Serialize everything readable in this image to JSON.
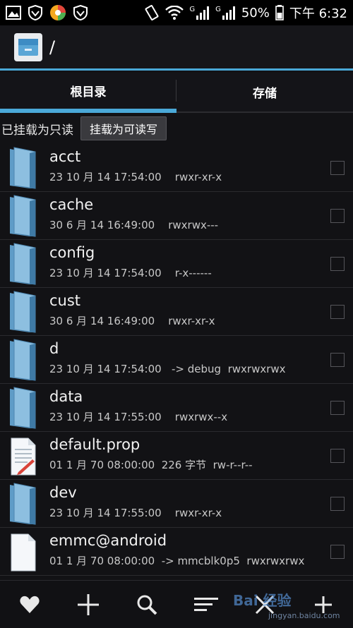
{
  "status_bar": {
    "battery_percent": "50%",
    "time": "下午 6:32",
    "network_label_1": "G",
    "network_label_2": "G"
  },
  "title_bar": {
    "path": "/"
  },
  "tabs": [
    {
      "label": "根目录",
      "active": true
    },
    {
      "label": "存储",
      "active": false
    }
  ],
  "mount": {
    "status_label": "已挂载为只读",
    "button_label": "挂载为可读写"
  },
  "files": [
    {
      "name": "acct",
      "meta": "23 10 月 14 17:54:00    rwxr-xr-x",
      "type": "folder"
    },
    {
      "name": "cache",
      "meta": "30 6 月 14 16:49:00    rwxrwx---",
      "type": "folder"
    },
    {
      "name": "config",
      "meta": "23 10 月 14 17:54:00    r-x------",
      "type": "folder"
    },
    {
      "name": "cust",
      "meta": "30 6 月 14 16:49:00    rwxr-xr-x",
      "type": "folder"
    },
    {
      "name": "d",
      "meta": "23 10 月 14 17:54:00   -> debug  rwxrwxrwx",
      "type": "folder"
    },
    {
      "name": "data",
      "meta": "23 10 月 14 17:55:00    rwxrwx--x",
      "type": "folder"
    },
    {
      "name": "default.prop",
      "meta": "01 1 月 70 08:00:00  226 字节  rw-r--r--",
      "type": "text-file"
    },
    {
      "name": "dev",
      "meta": "23 10 月 14 17:55:00    rwxr-xr-x",
      "type": "folder"
    },
    {
      "name": "emmc@android",
      "meta": "01 1 月 70 08:00:00  -> mmcblk0p5  rwxrwxrwx",
      "type": "file"
    }
  ],
  "bottom_bar": {
    "icons": [
      "heart-icon",
      "plus-icon",
      "search-icon",
      "sort-icon",
      "close-icon",
      "more-icon"
    ]
  },
  "watermark": {
    "text": "Bai 经验",
    "sub": "jingyan.baidu.com"
  },
  "colors": {
    "accent": "#4aa9d8",
    "background": "#121215",
    "folder": "#6fa8cf"
  }
}
